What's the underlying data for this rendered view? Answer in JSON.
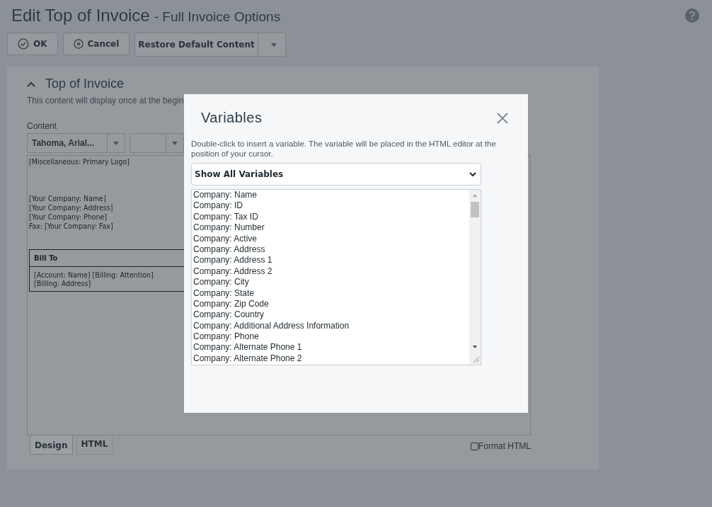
{
  "page": {
    "title": "Edit Top of Invoice",
    "subtitle": "- Full Invoice Options"
  },
  "toolbar": [
    {
      "label": "OK",
      "kind": "ok"
    },
    {
      "label": "Cancel",
      "kind": "cancel"
    },
    {
      "label": "Restore Default Content",
      "kind": "split"
    }
  ],
  "section": {
    "title": "Top of Invoice",
    "expanded": true,
    "description": "This content will display once at the begin",
    "content_label": "Content",
    "font_select": "Tahoma, Arial...",
    "editor_lines": [
      "[Miscellaneous: Primary Logo]",
      "[Your Company: Name]",
      "[Your Company: Address]",
      "[Your Company: Phone]",
      "Fax: [Your Company: Fax]"
    ],
    "bill_to": {
      "heading": "Bill To",
      "lines": [
        "[Account: Name] [Billing: Attention]",
        "[Billing: Address]"
      ]
    },
    "tabs": [
      {
        "label": "Design",
        "selected": true
      },
      {
        "label": "HTML",
        "selected": false
      }
    ],
    "format_html": {
      "label": "Format HTML",
      "checked": false
    }
  },
  "dialog": {
    "title": "Variables",
    "instructions": "Double-click to insert a variable. The variable will be placed in the HTML editor at the position of your cursor.",
    "filter": "Show All Variables",
    "variables": [
      "Company: Name",
      "Company: ID",
      "Company: Tax ID",
      "Company: Number",
      "Company: Active",
      "Company: Address",
      "Company: Address 1",
      "Company: Address 2",
      "Company: City",
      "Company: State",
      "Company: Zip Code",
      "Company: Country",
      "Company: Additional Address Information",
      "Company: Phone",
      "Company: Alternate Phone 1",
      "Company: Alternate Phone 2"
    ]
  }
}
